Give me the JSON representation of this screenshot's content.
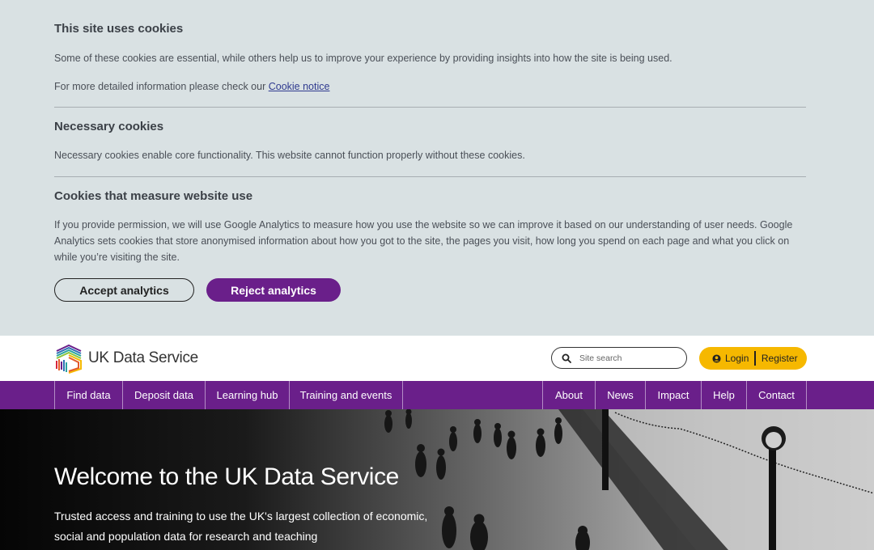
{
  "cookie_banner": {
    "title": "This site uses cookies",
    "intro": "Some of these cookies are essential, while others help us to improve your experience by providing insights into how the site is being used.",
    "notice_prefix": "For more detailed information please check our ",
    "notice_link": "Cookie notice",
    "necessary_title": "Necessary cookies",
    "necessary_text": "Necessary cookies enable core functionality. This website cannot function properly without these cookies.",
    "analytics_title": "Cookies that measure website use",
    "analytics_text": "If you provide permission, we will use Google Analytics to measure how you use the website so we can improve it based on our understanding of user needs. Google Analytics sets cookies that store anonymised information about how you got to the site, the pages you visit, how long you spend on each page and what you click on while you’re visiting the site.",
    "accept_label": "Accept analytics",
    "reject_label": "Reject analytics"
  },
  "header": {
    "logo_text": "UK Data Service",
    "search_placeholder": "Site search",
    "login_label": "Login",
    "register_label": "Register"
  },
  "nav": {
    "left": [
      "Find data",
      "Deposit data",
      "Learning hub",
      "Training and events"
    ],
    "right": [
      "About",
      "News",
      "Impact",
      "Help",
      "Contact"
    ]
  },
  "hero": {
    "title": "Welcome to the UK Data Service",
    "subtitle": "Trusted access and training to use the UK's largest collection of economic, social and population data for research and teaching"
  },
  "colors": {
    "banner_bg": "#d9e1e3",
    "brand_purple": "#6a1f8a",
    "account_yellow": "#f6b800"
  }
}
